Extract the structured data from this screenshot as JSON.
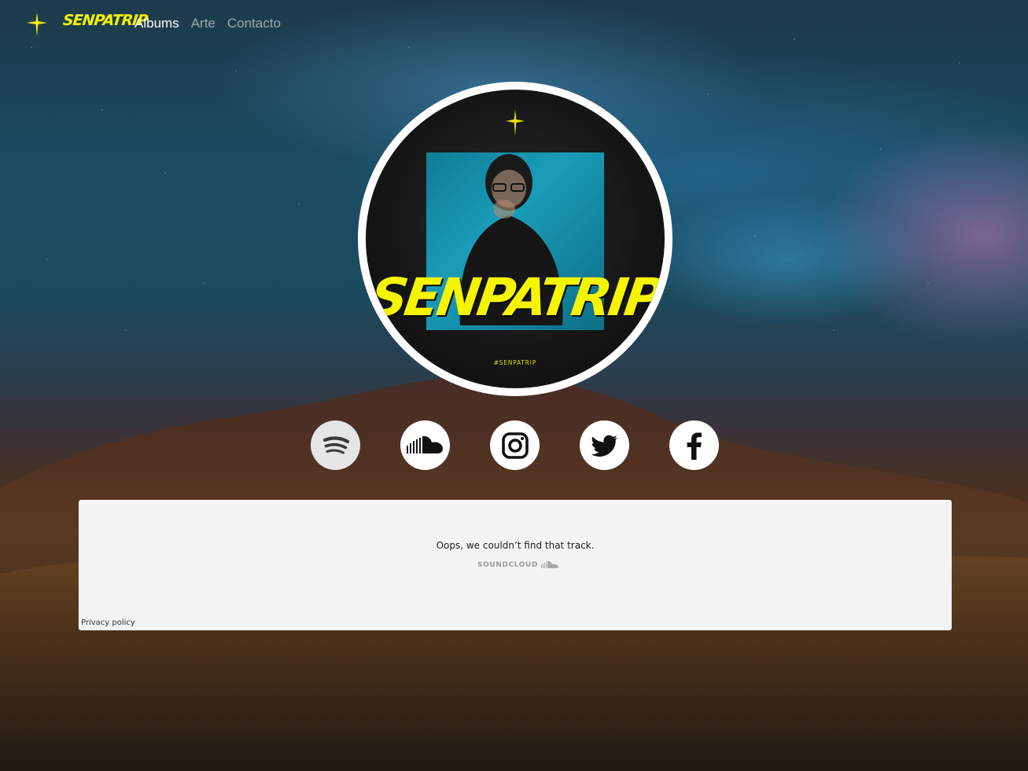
{
  "nav": {
    "logo_text": "SENPATRIP",
    "links": [
      {
        "label": "Albums",
        "active": true
      },
      {
        "label": "Arte",
        "active": false
      },
      {
        "label": "Contacto",
        "active": false
      }
    ]
  },
  "avatar": {
    "title": "SENPATRIP",
    "hashtag": "#SENPATRIP"
  },
  "social": [
    {
      "name": "spotify",
      "icon": "spotify-icon"
    },
    {
      "name": "soundcloud",
      "icon": "soundcloud-icon"
    },
    {
      "name": "instagram",
      "icon": "instagram-icon"
    },
    {
      "name": "twitter",
      "icon": "twitter-icon"
    },
    {
      "name": "facebook",
      "icon": "facebook-icon"
    }
  ],
  "embed": {
    "message": "Oops, we couldn’t find that track.",
    "brand": "SOUNDCLOUD",
    "privacy": "Privacy policy"
  },
  "colors": {
    "accent": "#f5f500",
    "nav_active": "#ffffff",
    "embed_bg": "#f4f4f4"
  }
}
